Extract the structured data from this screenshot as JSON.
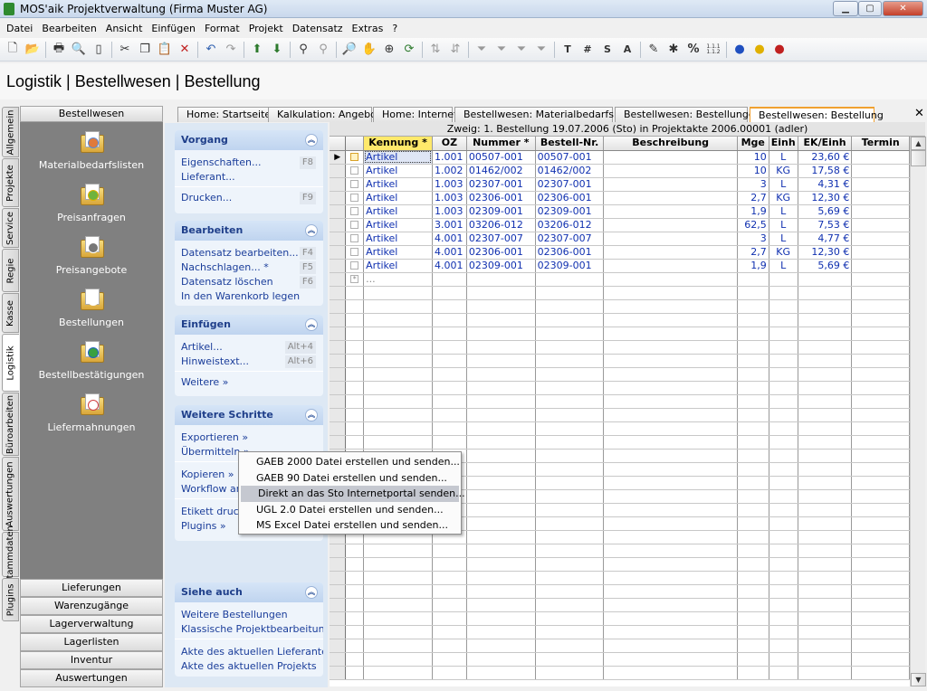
{
  "window": {
    "title": "MOS'aik Projektverwaltung (Firma Muster AG)",
    "min": "▁",
    "max": "▢",
    "close": "✕"
  },
  "menu": [
    "Datei",
    "Bearbeiten",
    "Ansicht",
    "Einfügen",
    "Format",
    "Projekt",
    "Datensatz",
    "Extras",
    "?"
  ],
  "toolbar": [
    "new-icon",
    "open-icon",
    "save-icon",
    "print-preview-icon",
    "print-icon",
    "page-icon",
    "cut-icon",
    "copy-icon",
    "paste-icon",
    "delete-icon",
    "undo-icon",
    "redo-icon",
    "up-arrow-icon",
    "down-arrow-icon",
    "binoculars-icon",
    "binoculars-next-icon",
    "search-icon",
    "hand-icon",
    "zoom-icon",
    "refresh-icon",
    "sort-asc-icon",
    "sort-desc-icon",
    "filter-icon",
    "filter-add-icon",
    "filter-clear-icon",
    "filter-edit-icon",
    "T",
    "#",
    "S",
    "A",
    "edit-list-icon",
    "percent-calc-icon",
    "%",
    "1.1.1",
    "user-blue-icon",
    "user-yellow-icon",
    "user-red-icon"
  ],
  "toolbar_text": {
    "t": "T",
    "hash": "#",
    "s": "S",
    "a": "A",
    "pct": "%",
    "num": "1.1.1 1.1.2"
  },
  "page_title": "Logistik | Bestellwesen | Bestellung",
  "vtabs": [
    "Allgemein",
    "Projekte",
    "Service",
    "Regie",
    "Kasse",
    "Logistik",
    "Büroarbeiten",
    "Auswertungen",
    "Stammdaten",
    "Plugins"
  ],
  "nav": {
    "header": "Bestellwesen",
    "items": [
      "Materialbedarfslisten",
      "Preisanfragen",
      "Preisangebote",
      "Bestellungen",
      "Bestellbestätigungen",
      "Liefermahnungen"
    ],
    "bottom": [
      "Lieferungen",
      "Warenzugänge",
      "Lagerverwaltung",
      "Lagerlisten",
      "Inventur",
      "Auswertungen"
    ]
  },
  "doc_tabs": [
    "Home: Startseite",
    "Kalkulation: Angebot",
    "Home: Internet",
    "Bestellwesen: Materialbedarfsliste",
    "Bestellwesen: Bestellungen",
    "Bestellwesen: Bestellung"
  ],
  "tasks": {
    "vorgang": {
      "title": "Vorgang",
      "items": [
        {
          "label": "Eigenschaften...",
          "key": "F8"
        },
        {
          "label": "Lieferant...",
          "key": ""
        },
        {
          "label": "Drucken...",
          "key": "F9"
        }
      ]
    },
    "bearbeiten": {
      "title": "Bearbeiten",
      "items": [
        {
          "label": "Datensatz bearbeiten...",
          "key": "F4"
        },
        {
          "label": "Nachschlagen...  *",
          "key": "F5"
        },
        {
          "label": "Datensatz löschen",
          "key": "F6"
        },
        {
          "label": "In den Warenkorb legen",
          "key": ""
        }
      ]
    },
    "einfuegen": {
      "title": "Einfügen",
      "items": [
        {
          "label": "Artikel...",
          "key": "Alt+4"
        },
        {
          "label": "Hinweistext...",
          "key": "Alt+6"
        },
        {
          "label": "Weitere »",
          "key": ""
        }
      ]
    },
    "weitere": {
      "title": "Weitere Schritte",
      "items": [
        {
          "label": "Exportieren »"
        },
        {
          "label": "Übermitteln »"
        },
        {
          "label": "Kopieren »"
        },
        {
          "label": "Workflow ana"
        },
        {
          "label": "Etikett drucke"
        },
        {
          "label": "Plugins »"
        }
      ]
    },
    "siehe": {
      "title": "Siehe auch",
      "items": [
        {
          "label": "Weitere Bestellungen"
        },
        {
          "label": "Klassische Projektbearbeitung"
        },
        {
          "label": "Akte des aktuellen Lieferanten"
        },
        {
          "label": "Akte des aktuellen Projekts"
        }
      ]
    }
  },
  "grid": {
    "info": "Zweig: 1. Bestellung 19.07.2006 (Sto) in Projektakte 2006.00001 (adler)",
    "columns": [
      "Kennung *",
      "OZ",
      "Nummer *",
      "Bestell-Nr.",
      "Beschreibung",
      "Mge",
      "Einh",
      "EK/Einh",
      "Termin"
    ],
    "rows": [
      [
        "Artikel",
        "1.001",
        "00507-001",
        "00507-001",
        "",
        "10",
        "L",
        "23,60 €",
        ""
      ],
      [
        "Artikel",
        "1.002",
        "01462/002",
        "01462/002",
        "",
        "10",
        "KG",
        "17,58 €",
        ""
      ],
      [
        "Artikel",
        "1.003",
        "02307-001",
        "02307-001",
        "",
        "3",
        "L",
        "4,31 €",
        ""
      ],
      [
        "Artikel",
        "1.003",
        "02306-001",
        "02306-001",
        "",
        "2,7",
        "KG",
        "12,30 €",
        ""
      ],
      [
        "Artikel",
        "1.003",
        "02309-001",
        "02309-001",
        "",
        "1,9",
        "L",
        "5,69 €",
        ""
      ],
      [
        "Artikel",
        "3.001",
        "03206-012",
        "03206-012",
        "",
        "62,5",
        "L",
        "7,53 €",
        ""
      ],
      [
        "Artikel",
        "4.001",
        "02307-007",
        "02307-007",
        "",
        "3",
        "L",
        "4,77 €",
        ""
      ],
      [
        "Artikel",
        "4.001",
        "02306-001",
        "02306-001",
        "",
        "2,7",
        "KG",
        "12,30 €",
        ""
      ],
      [
        "Artikel",
        "4.001",
        "02309-001",
        "02309-001",
        "",
        "1,9",
        "L",
        "5,69 €",
        ""
      ]
    ],
    "new_row": "...",
    "new_marker": "*",
    "current_marker": "▶"
  },
  "context_menu": [
    "GAEB 2000 Datei erstellen und senden...",
    "GAEB 90 Datei erstellen und senden...",
    "Direkt an das Sto Internetportal senden...",
    "UGL 2.0 Datei erstellen und senden...",
    "MS Excel Datei erstellen und senden..."
  ],
  "context_menu_highlight": 2
}
